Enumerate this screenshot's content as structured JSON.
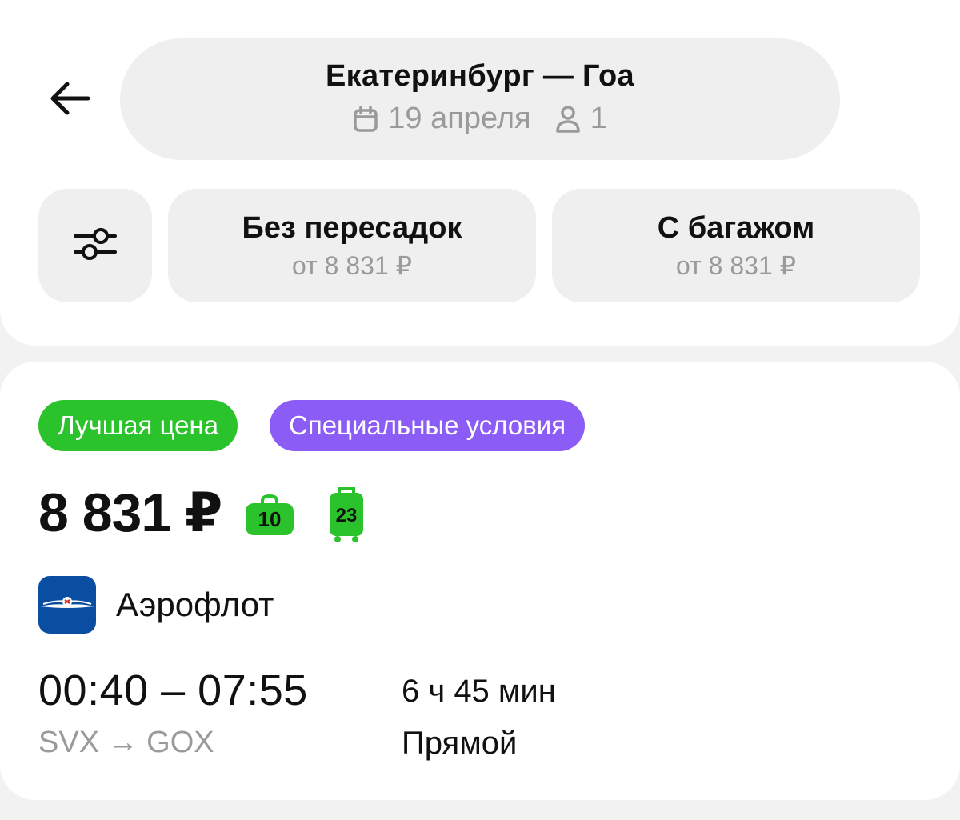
{
  "header": {
    "route_title": "Екатеринбург — Гоа",
    "date": "19 апреля",
    "passengers": "1"
  },
  "icons": {
    "back": "arrow-left-icon",
    "calendar": "calendar-icon",
    "passenger": "person-icon",
    "filters": "sliders-icon",
    "hand_luggage": "hand-luggage-icon",
    "checked_baggage": "suitcase-icon"
  },
  "filters": {
    "chips": [
      {
        "title": "Без пересадок",
        "subtitle": "от 8 831 ₽"
      },
      {
        "title": "С багажом",
        "subtitle": "от 8 831 ₽"
      }
    ]
  },
  "ticket": {
    "badges": [
      {
        "label": "Лучшая цена",
        "color": "#2bc32b"
      },
      {
        "label": "Специальные условия",
        "color": "#8b5cf6"
      }
    ],
    "price": "8 831 ₽",
    "hand_luggage_kg": "10",
    "baggage_kg": "23",
    "airline": "Аэрофлот",
    "time_range": "00:40 – 07:55",
    "route_codes": "SVX → GOX",
    "duration": "6 ч 45 мин",
    "stops": "Прямой"
  },
  "colors": {
    "accent_green": "#2bc32b",
    "accent_purple": "#8b5cf6",
    "airline_blue": "#0a4ea2",
    "muted_text": "#9a9a9a"
  }
}
